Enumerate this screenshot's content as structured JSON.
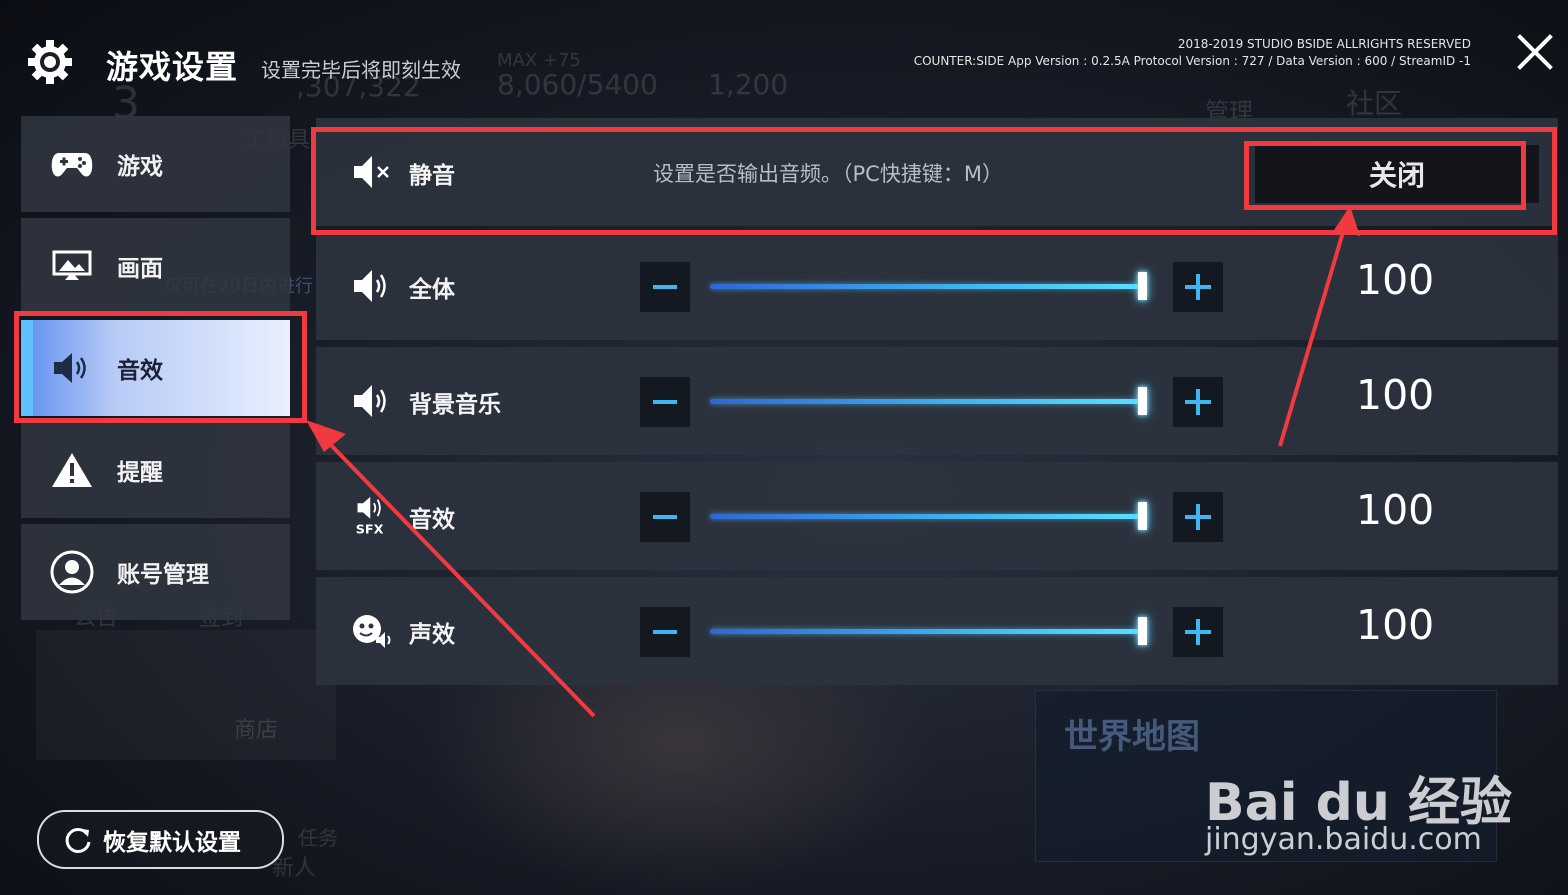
{
  "background": {
    "hud_stats": [
      "3",
      ",307,322",
      "MAX +75",
      "8,060/5400",
      "1,200",
      "工机具",
      "管理",
      "社区",
      "公告",
      "签到",
      "商店",
      "任务",
      "新人",
      "仅可在29日内进行"
    ],
    "world_map_label": "世界地图"
  },
  "header": {
    "title": "游戏设置",
    "subtitle": "设置完毕后将即刻生效",
    "copyright": "2018-2019 STUDIO BSIDE ALLRIGHTS RESERVED",
    "version": "COUNTER:SIDE App Version : 0.2.5A Protocol Version : 727 / Data Version : 600 / StreamID -1"
  },
  "sidebar": {
    "items": [
      {
        "label": "游戏",
        "icon": "gamepad-icon",
        "active": false
      },
      {
        "label": "画面",
        "icon": "display-icon",
        "active": false
      },
      {
        "label": "音效",
        "icon": "speaker-icon",
        "active": true
      },
      {
        "label": "提醒",
        "icon": "warning-icon",
        "active": false
      },
      {
        "label": "账号管理",
        "icon": "account-icon",
        "active": false
      }
    ],
    "reset_label": "恢复默认设置"
  },
  "settings": {
    "mute": {
      "label": "静音",
      "description": "设置是否输出音频。（PC快捷键：M）",
      "toggle_value": "关闭"
    },
    "rows": [
      {
        "label": "全体",
        "icon": "speaker-icon",
        "value": "100"
      },
      {
        "label": "背景音乐",
        "icon": "speaker-icon",
        "value": "100"
      },
      {
        "label": "音效",
        "icon": "sfx-icon",
        "value": "100"
      },
      {
        "label": "声效",
        "icon": "voice-icon",
        "value": "100"
      }
    ]
  },
  "watermark": {
    "brand": "Bai du 经验",
    "url": "jingyan.baidu.com"
  },
  "colors": {
    "accent": "#3fb6f0",
    "annotation": "#f03a3f",
    "active_tab": "#5fc0ff"
  }
}
